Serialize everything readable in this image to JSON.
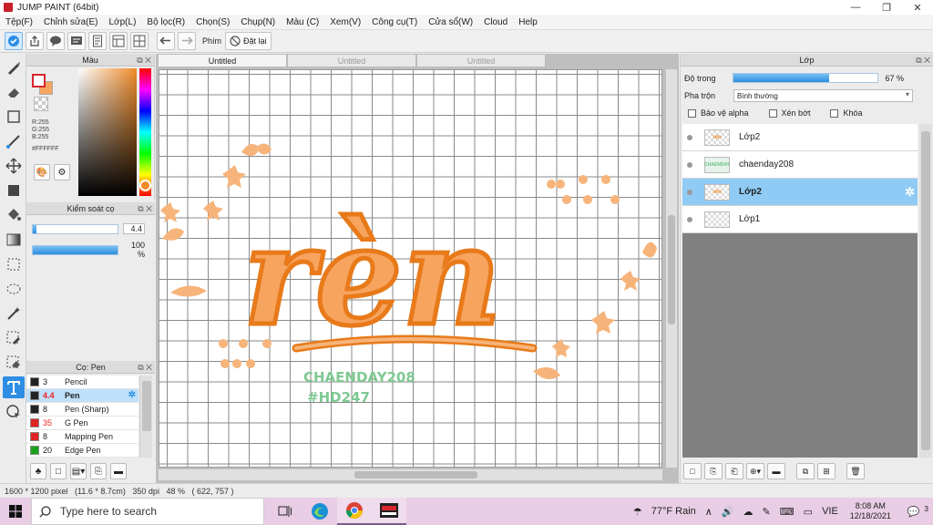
{
  "window": {
    "title": "JUMP PAINT (64bit)",
    "minimize": "—",
    "maximize": "❐",
    "close": "✕"
  },
  "menu": [
    "Tệp(F)",
    "Chỉnh sửa(E)",
    "Lớp(L)",
    "Bộ lọc(R)",
    "Chọn(S)",
    "Chụp(N)",
    "Màu (C)",
    "Xem(V)",
    "Công cụ(T)",
    "Cửa sổ(W)",
    "Cloud",
    "Help"
  ],
  "toolbar": {
    "filter_label": "Phím",
    "reset_label": "Đặt lại"
  },
  "color_panel": {
    "title": "Màu",
    "r": "R:255",
    "g": "G:255",
    "b": "B:255",
    "hex": "#FFFFFF",
    "fg_color": "#FFFFFF",
    "bg_color": "#F7A45F"
  },
  "brush_control": {
    "title": "Kiểm soát cọ",
    "size_value": "4.4",
    "opacity_value": "100 %",
    "size_fraction": 0.04,
    "opacity_fraction": 1.0
  },
  "pen_panel": {
    "title": "Cọ: Pen",
    "pens": [
      {
        "size": "3",
        "name": "Pencil",
        "color": "#222222"
      },
      {
        "size": "4.4",
        "name": "Pen",
        "color": "#222222",
        "selected": true
      },
      {
        "size": "8",
        "name": "Pen (Sharp)",
        "color": "#222222"
      },
      {
        "size": "35",
        "name": "G Pen",
        "color": "#e02424"
      },
      {
        "size": "8",
        "name": "Mapping Pen",
        "color": "#e02424"
      },
      {
        "size": "20",
        "name": "Edge Pen",
        "color": "#1aa31a"
      }
    ]
  },
  "tabs": [
    "Untitled",
    "Untitled",
    "Untitled"
  ],
  "artwork": {
    "title": "rèn",
    "watermark_line1": "CHAENDAY208",
    "watermark_line2": "#HD247"
  },
  "layer_panel": {
    "title": "Lớp",
    "opacity_label": "Độ trong",
    "opacity_value": "67 %",
    "opacity_fraction": 0.67,
    "blend_label": "Pha trộn",
    "blend_value": "Bình thường",
    "protect_alpha": "Bảo vệ alpha",
    "clipping": "Xén bớt",
    "lock": "Khóa",
    "layers": [
      {
        "name": "Lớp2",
        "thumb": "rèn"
      },
      {
        "name": "chaenday208",
        "thumb": "CHAENDAY"
      },
      {
        "name": "Lớp2",
        "thumb": "rèn",
        "selected": true
      },
      {
        "name": "Lớp1",
        "thumb": ""
      }
    ]
  },
  "status": {
    "text": "1600 * 1200 pixel   (11.6 * 8.7cm)   350 dpi   48 %   ( 622, 757 )"
  },
  "taskbar": {
    "search_placeholder": "Type here to search",
    "weather": "77°F  Rain",
    "language": "VIE",
    "time": "8:08 AM",
    "date": "12/18/2021",
    "notifications": "3"
  }
}
